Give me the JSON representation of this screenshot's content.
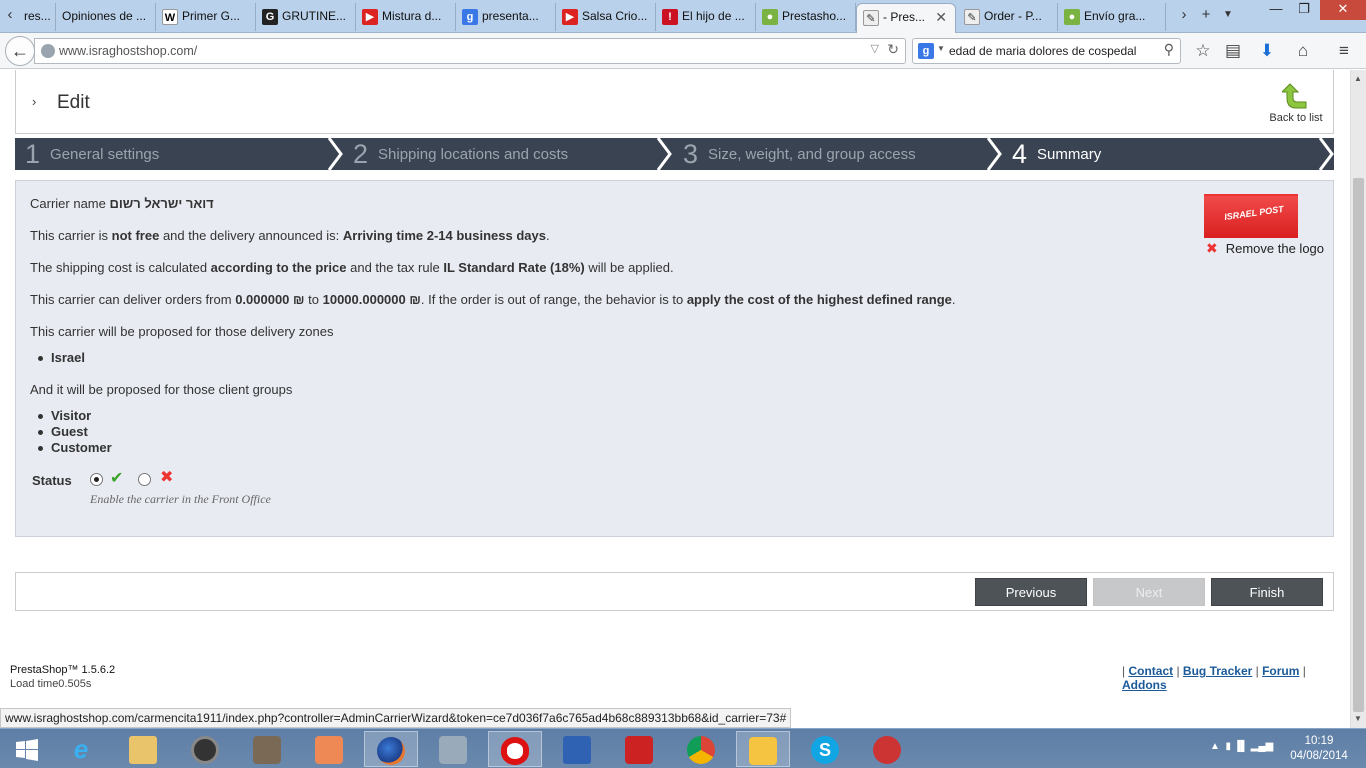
{
  "browser": {
    "tabs": [
      {
        "title": "res..."
      },
      {
        "title": "Opiniones de ..."
      },
      {
        "title": "Primer G..."
      },
      {
        "title": "GRUTINE..."
      },
      {
        "title": "Mistura d..."
      },
      {
        "title": "presenta..."
      },
      {
        "title": "Salsa Crio..."
      },
      {
        "title": "El hijo de ..."
      },
      {
        "title": "Prestasho..."
      },
      {
        "title": "- Pres..."
      },
      {
        "title": "Order - P..."
      },
      {
        "title": "Envío gra..."
      }
    ],
    "active_tab_index": 9,
    "url": "www.israghostshop.com/",
    "search_text": "edad de maria dolores de cospedal",
    "status_url": "www.israghostshop.com/carmencita1911/index.php?controller=AdminCarrierWizard&token=ce7d036f7a6c765ad4b68c889313bb68&id_carrier=73#"
  },
  "page": {
    "title": "Edit",
    "back_to_list": "Back to list",
    "steps": [
      {
        "num": "1",
        "label": "General settings"
      },
      {
        "num": "2",
        "label": "Shipping locations and costs"
      },
      {
        "num": "3",
        "label": "Size, weight, and group access"
      },
      {
        "num": "4",
        "label": "Summary"
      }
    ],
    "active_step": 4,
    "summary": {
      "carrier_label": "Carrier name",
      "carrier_name": "דואר ישראל רשום",
      "free_pre": "This carrier is",
      "free_value": "not free",
      "free_mid": "and the delivery announced is:",
      "delay": "Arriving time 2-14 business days",
      "cost_pre": "The shipping cost is calculated",
      "cost_method": "according to the price",
      "cost_mid": "and the tax rule",
      "tax_rule": "IL Standard Rate (18%)",
      "cost_post": "will be applied.",
      "range_pre": "This carrier can deliver orders from",
      "range_from": "0.000000 ₪",
      "range_to_word": "to",
      "range_to": "10000.000000 ₪",
      "range_mid": ". If the order is out of range, the behavior is to",
      "range_behavior": "apply the cost of the highest defined range",
      "zones_intro": "This carrier will be proposed for those delivery zones",
      "zones": [
        "Israel"
      ],
      "groups_intro": "And it will be proposed for those client groups",
      "groups": [
        "Visitor",
        "Guest",
        "Customer"
      ],
      "status_label": "Status",
      "status_enabled": true,
      "status_hint": "Enable the carrier in the Front Office",
      "logo_text": "ISRAEL POST",
      "remove_logo": "Remove the logo"
    },
    "buttons": {
      "previous": "Previous",
      "next": "Next",
      "finish": "Finish"
    },
    "footer": {
      "version": "PrestaShop™ 1.5.6.2",
      "load_time": "Load time0.505s",
      "links": [
        "Contact",
        "Bug Tracker",
        "Forum",
        "Addons"
      ]
    }
  },
  "taskbar": {
    "time": "10:19",
    "date": "04/08/2014"
  },
  "colors": {
    "steps_bg": "#3a4352",
    "panel_bg": "#e8ebf2",
    "button_dark": "#4e5358",
    "button_disabled": "#c7c8c9",
    "link": "#1a5a99"
  }
}
